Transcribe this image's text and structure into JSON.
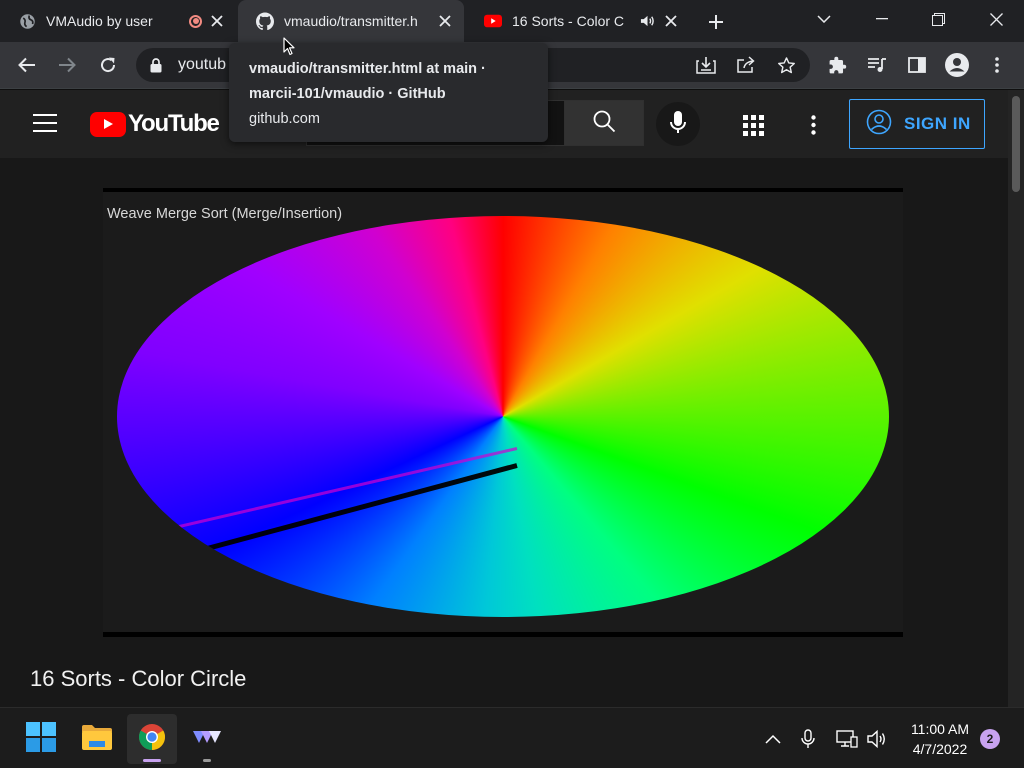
{
  "browser": {
    "tabs": [
      {
        "title": "VMAudio by user",
        "favicon": "globe-icon",
        "recording": true,
        "active": false
      },
      {
        "title": "vmaudio/transmitter.h",
        "favicon": "github-icon",
        "active": true
      },
      {
        "title": "16 Sorts - Color C",
        "favicon": "youtube-icon",
        "audio": true,
        "active": false
      }
    ],
    "omnibox_url": "youtub",
    "tooltip": {
      "line1": "vmaudio/transmitter.html at main ·",
      "line2": "marcii-101/vmaudio · GitHub",
      "line3": "github.com"
    }
  },
  "youtube": {
    "brand": "YouTube",
    "sign_in": "SIGN IN",
    "video_title": "16 Sorts - Color Circle",
    "player_overlay_text": "Weave Merge Sort (Merge/Insertion)"
  },
  "taskbar": {
    "time": "11:00 AM",
    "date": "4/7/2022",
    "notification_count": "2",
    "apps": [
      "start-icon",
      "file-explorer-icon",
      "chrome-icon",
      "vmaudio-app-icon"
    ]
  },
  "colors": {
    "youtube_red": "#ff0000",
    "signin_blue": "#3ea6ff",
    "chrome_dark": "#202124"
  }
}
